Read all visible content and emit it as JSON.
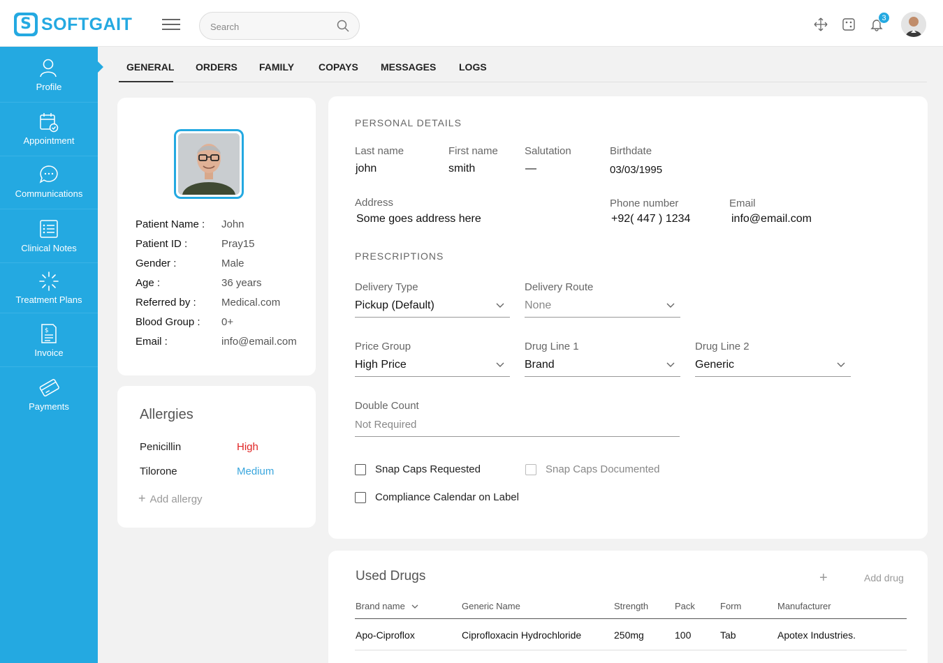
{
  "header": {
    "logo_text": "SOFTGAIT",
    "logo_mark": "S",
    "search_placeholder": "Search",
    "notification_count": "3",
    "icons": [
      "menu-icon",
      "search-icon",
      "move-arrows-icon",
      "dice-icon",
      "bell-icon"
    ]
  },
  "sidebar": {
    "items": [
      {
        "label": "Profile",
        "icon": "user-icon"
      },
      {
        "label": "Appointment",
        "icon": "calendar-check-icon"
      },
      {
        "label": "Communications",
        "icon": "chat-bubble-icon"
      },
      {
        "label": "Clinical Notes",
        "icon": "checklist-icon"
      },
      {
        "label": "Treatment Plans",
        "icon": "spinner-icon"
      },
      {
        "label": "Invoice",
        "icon": "invoice-icon"
      },
      {
        "label": "Payments",
        "icon": "card-icon"
      }
    ],
    "active": "Profile"
  },
  "tabs": [
    "GENERAL",
    "ORDERS",
    "FAMILY",
    "COPAYS",
    "MESSAGES",
    "LOGS"
  ],
  "active_tab": "GENERAL",
  "patient": {
    "rows": [
      {
        "label": "Patient Name :",
        "value": "John"
      },
      {
        "label": "Patient ID :",
        "value": "Pray15"
      },
      {
        "label": "Gender :",
        "value": "Male"
      },
      {
        "label": "Age :",
        "value": "36 years"
      },
      {
        "label": "Referred by :",
        "value": "Medical.com"
      },
      {
        "label": "Blood Group :",
        "value": "0+"
      },
      {
        "label": "Email :",
        "value": "info@email.com"
      }
    ]
  },
  "allergies": {
    "title": "Allergies",
    "items": [
      {
        "name": "Penicillin",
        "severity": "High",
        "color": "#e02424"
      },
      {
        "name": "Tilorone",
        "severity": "Medium",
        "color": "#3aa6dd"
      }
    ],
    "add_label": "Add allergy"
  },
  "personal": {
    "title": "PERSONAL DETAILS",
    "last_name_label": "Last name",
    "last_name": "john",
    "first_name_label": "First name",
    "first_name": "smith",
    "salutation_label": "Salutation",
    "salutation": "—",
    "birthdate_label": "Birthdate",
    "birthdate": "03/03/1995",
    "address_label": "Address",
    "address": "Some goes address here",
    "phone_label": "Phone number",
    "phone": "+92( 447 ) 1234",
    "email_label": "Email",
    "email": "info@email.com"
  },
  "prescriptions": {
    "title": "PRESCRIPTIONS",
    "delivery_type_label": "Delivery Type",
    "delivery_type": "Pickup (Default)",
    "delivery_route_label": "Delivery Route",
    "delivery_route": "None",
    "price_group_label": "Price Group",
    "price_group": "High Price",
    "drug_line1_label": "Drug Line 1",
    "drug_line1": "Brand",
    "drug_line2_label": "Drug Line 2",
    "drug_line2": "Generic",
    "double_count_label": "Double Count",
    "double_count": "Not Required",
    "snap_caps_requested": "Snap Caps Requested",
    "snap_caps_documented": "Snap Caps Documented",
    "compliance_calendar": "Compliance Calendar on Label"
  },
  "used_drugs": {
    "title": "Used Drugs",
    "add_label": "Add drug",
    "columns": [
      "Brand name",
      "Generic Name",
      "Strength",
      "Pack",
      "Form",
      "Manufacturer"
    ],
    "rows": [
      [
        "Apo-Ciproflox",
        "Ciprofloxacin Hydrochloride",
        "250mg",
        "100",
        "Tab",
        "Apotex Industries."
      ]
    ]
  },
  "colors": {
    "accent": "#24a9e1",
    "high": "#e02424",
    "medium": "#3aa6dd"
  }
}
